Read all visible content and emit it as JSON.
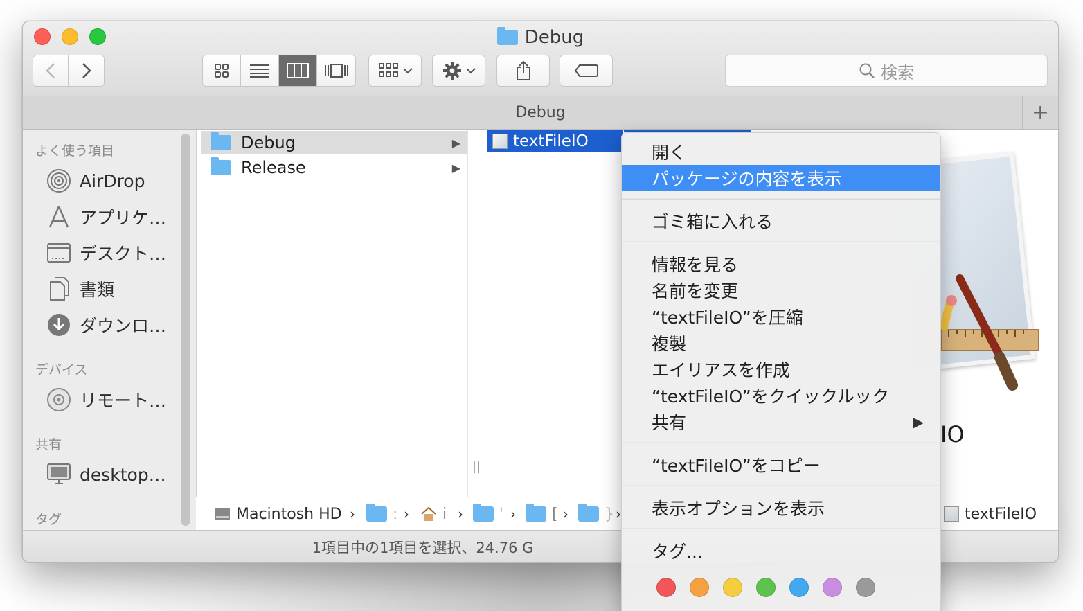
{
  "window": {
    "title": "Debug",
    "tab_title": "Debug",
    "tab_add": "+"
  },
  "toolbar": {
    "back_icon": "chevron-left-icon",
    "forward_icon": "chevron-right-icon",
    "view_modes": [
      "icon-view-icon",
      "list-view-icon",
      "column-view-icon",
      "cover-flow-icon"
    ],
    "active_view": "column-view-icon",
    "search_placeholder": "検索"
  },
  "sidebar": {
    "favorites_header": "よく使う項目",
    "favorites": [
      {
        "label": "AirDrop",
        "icon": "airdrop-icon"
      },
      {
        "label": "アプリケ…",
        "icon": "applications-icon"
      },
      {
        "label": "デスクト…",
        "icon": "desktop-icon"
      },
      {
        "label": "書類",
        "icon": "documents-icon"
      },
      {
        "label": "ダウンロ…",
        "icon": "downloads-icon"
      }
    ],
    "devices_header": "デバイス",
    "devices": [
      {
        "label": "リモート…",
        "icon": "remote-disc-icon"
      }
    ],
    "shared_header": "共有",
    "shared": [
      {
        "label": "desktop…",
        "icon": "computer-icon"
      }
    ],
    "tags_header": "タグ"
  },
  "columns": {
    "col1": [
      {
        "label": "Debug",
        "selected": true
      },
      {
        "label": "Release",
        "selected": false
      }
    ],
    "col2_selected_file": "textFileIO"
  },
  "preview": {
    "name_fragment": "IO"
  },
  "pathbar": {
    "items": [
      {
        "label": "Macintosh HD",
        "icon": "hard-drive-icon"
      },
      {
        "label": "",
        "icon": "user-folder-icon"
      },
      {
        "label": "",
        "icon": "home-icon"
      },
      {
        "label": "",
        "icon": "library-folder-icon"
      },
      {
        "label": "",
        "icon": "folder-icon"
      },
      {
        "label": "",
        "icon": "folder-icon"
      },
      {
        "label": "textFileIO",
        "icon": "app-icon"
      }
    ],
    "partial_chars": [
      ":",
      "i",
      "'",
      "[",
      "}"
    ]
  },
  "statusbar": {
    "text": "1項目中の1項目を選択、24.76 G"
  },
  "context_menu": {
    "items": [
      {
        "label": "開く"
      },
      {
        "label": "パッケージの内容を表示",
        "highlighted": true
      },
      {
        "label": "ゴミ箱に入れる"
      },
      {
        "label": "情報を見る"
      },
      {
        "label": "名前を変更"
      },
      {
        "label": "“textFileIO”を圧縮"
      },
      {
        "label": "複製"
      },
      {
        "label": "エイリアスを作成"
      },
      {
        "label": "“textFileIO”をクイックルック"
      },
      {
        "label": "共有",
        "submenu": true
      },
      {
        "label": "“textFileIO”をコピー"
      },
      {
        "label": "表示オプションを表示"
      },
      {
        "label": "タグ..."
      }
    ],
    "tag_colors": [
      "#f25757",
      "#f5a142",
      "#f5cd41",
      "#5ec34e",
      "#42a9f0",
      "#c98ee0",
      "#9a9a9a"
    ],
    "submenu_arrow": "▶"
  }
}
